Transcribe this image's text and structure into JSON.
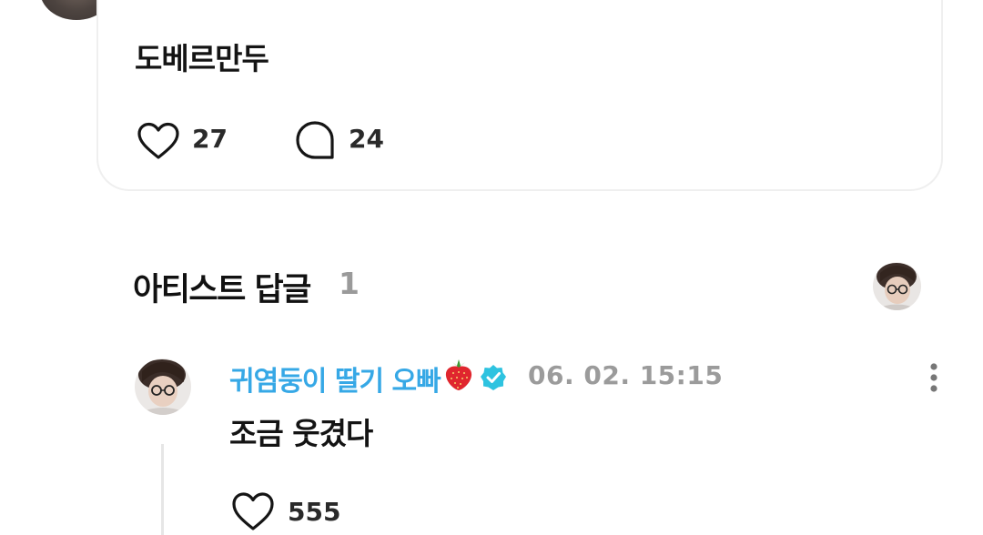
{
  "post": {
    "text": "도베르만두",
    "like_count": "27",
    "comment_count": "24",
    "icons": {
      "like": "heart-outline-icon",
      "comment": "speech-bubble-icon"
    }
  },
  "artist_replies": {
    "title": "아티스트 답글",
    "count": "1"
  },
  "reply": {
    "author_name": "귀염둥이 딸기 오빠",
    "author_emoji": "strawberry-icon",
    "verified": true,
    "timestamp": "06. 02. 15:15",
    "text": "조금 웃겼다",
    "like_count": "555",
    "name_color": "#36a8e6",
    "verified_color": "#2ec3e0"
  }
}
